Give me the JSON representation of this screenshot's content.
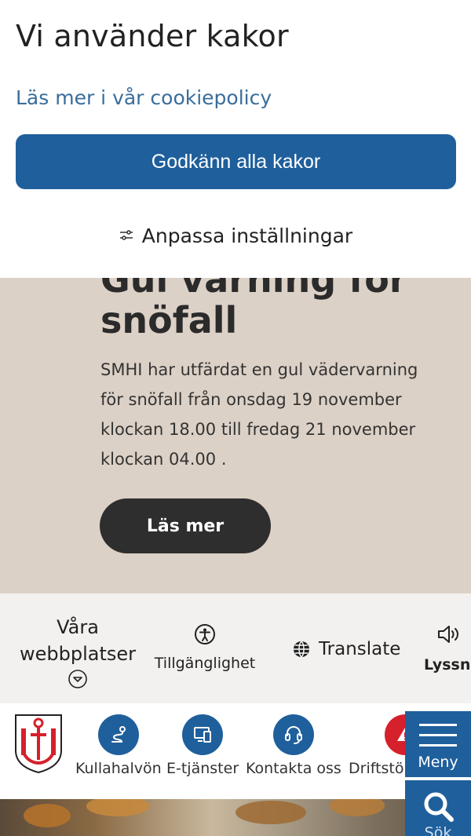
{
  "cookie": {
    "title": "Vi använder kakor",
    "policy_link": "Läs mer i vår cookiepolicy",
    "accept_label": "Godkänn alla kakor",
    "customize_label": "Anpassa inställningar"
  },
  "alert": {
    "title": "Gul varning för snöfall",
    "body": "SMHI har utfärdat en gul vädervarning för snöfall från onsdag 19 november klockan 18.00 till fredag 21 november klockan 04.00 .",
    "button_label": "Läs mer"
  },
  "tools": {
    "sites_label": "Våra webbplatser",
    "accessibility_label": "Tillgänglighet",
    "translate_label": "Translate",
    "listen_label": "Lyssna"
  },
  "quicklinks": [
    {
      "label": "Kullahalvön",
      "icon": "route-icon"
    },
    {
      "label": "E-tjänster",
      "icon": "devices-icon"
    },
    {
      "label": "Kontakta oss",
      "icon": "headset-icon"
    },
    {
      "label": "Driftstörningar",
      "icon": "warning-icon"
    }
  ],
  "header": {
    "menu_label": "Meny",
    "search_label": "Sök"
  },
  "colors": {
    "primary": "#1f5f9c",
    "alert_bg": "#dcd1c6",
    "tools_bg": "#f3f1ef",
    "dark_button": "#2e2e2e",
    "warning": "#d6202c"
  }
}
